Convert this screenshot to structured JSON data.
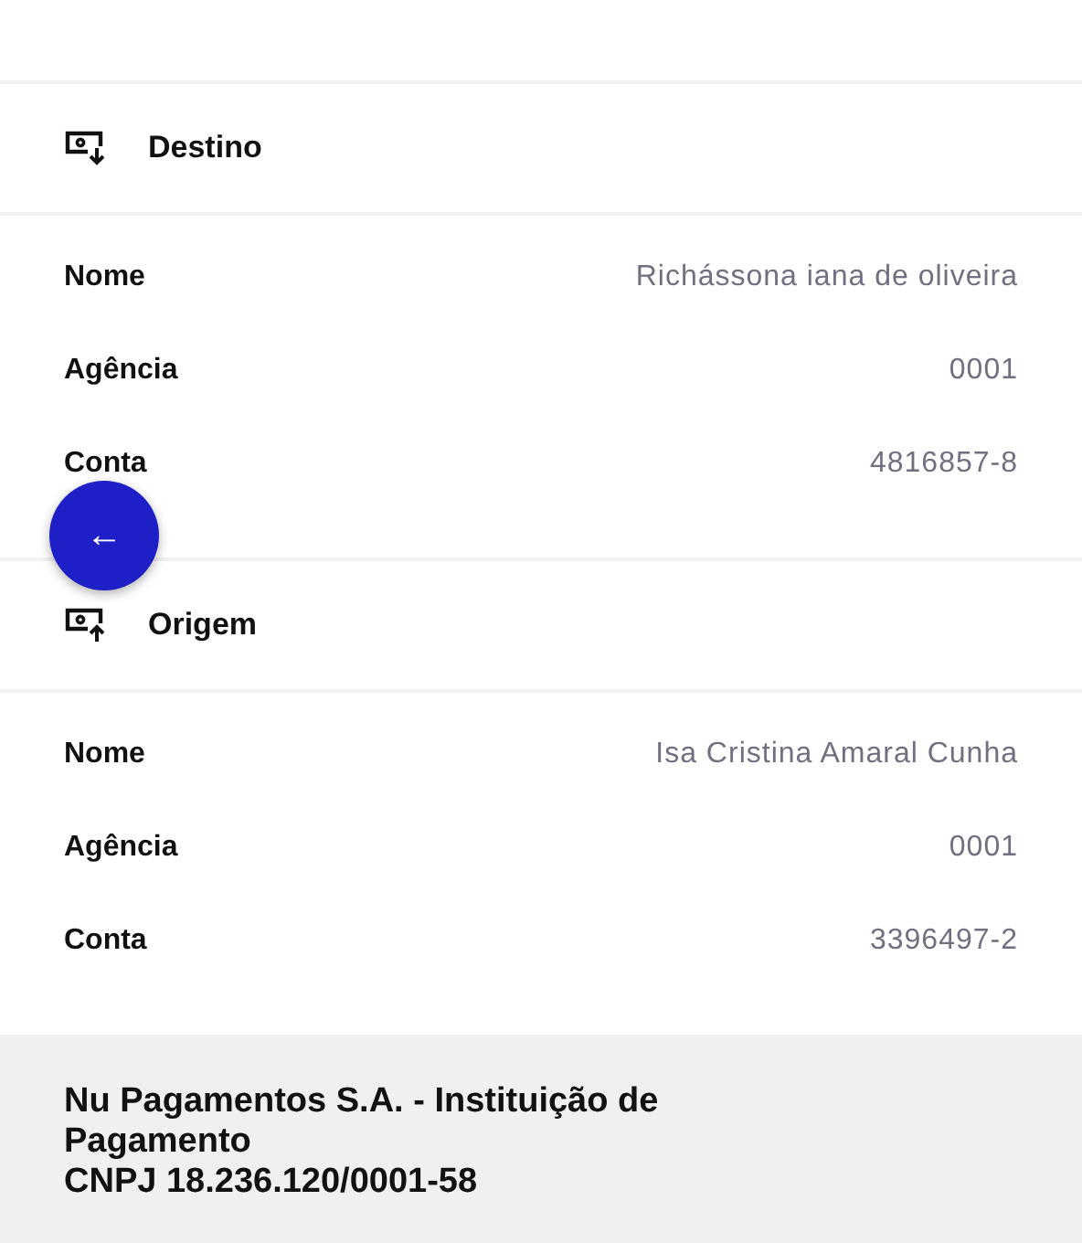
{
  "sections": [
    {
      "title": "Destino",
      "kind": "incoming",
      "rows": [
        {
          "label": "Nome",
          "value": "Richássona iana de oliveira"
        },
        {
          "label": "Agência",
          "value": "0001"
        },
        {
          "label": "Conta",
          "value": "4816857-8"
        }
      ]
    },
    {
      "title": "Origem",
      "kind": "outgoing",
      "rows": [
        {
          "label": "Nome",
          "value": "Isa Cristina Amaral Cunha"
        },
        {
          "label": "Agência",
          "value": "0001"
        },
        {
          "label": "Conta",
          "value": "3396497-2"
        }
      ]
    }
  ],
  "back_button": {
    "label": "←"
  },
  "footer": {
    "company": "Nu Pagamentos S.A. - Instituição de Pagamento",
    "cnpj": "CNPJ 18.236.120/0001-58"
  }
}
